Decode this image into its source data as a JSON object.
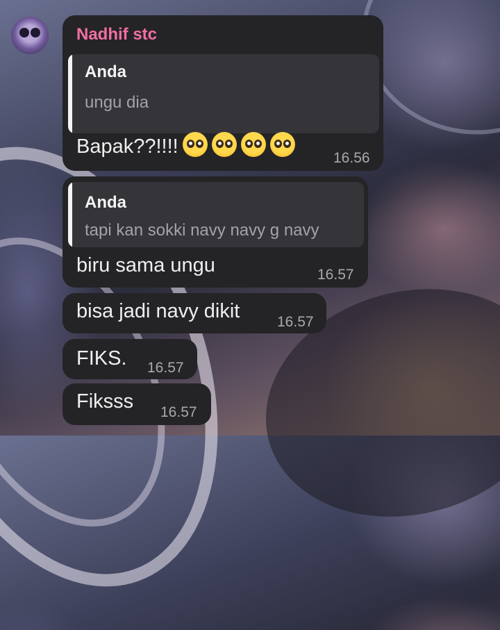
{
  "sender": {
    "name": "Nadhif stc"
  },
  "messages": [
    {
      "quote": {
        "author": "Anda",
        "text": "ungu dia"
      },
      "text": "Bapak??!!!!",
      "emoji_count": 4,
      "emoji_icon": "pleading-face-icon",
      "time": "16.56"
    },
    {
      "quote": {
        "author": "Anda",
        "text": "tapi kan sokki navy navy g navy"
      },
      "text": "biru sama ungu",
      "time": "16.57"
    },
    {
      "text": "bisa jadi navy dikit",
      "time": "16.57"
    },
    {
      "text": "FIKS.",
      "time": "16.57"
    },
    {
      "text": "Fiksss",
      "time": "16.57"
    }
  ],
  "colors": {
    "bubble": "#242326",
    "quote_bg": "#353438",
    "sender_name": "#f06fa3",
    "timestamp": "#a9a9ad"
  }
}
